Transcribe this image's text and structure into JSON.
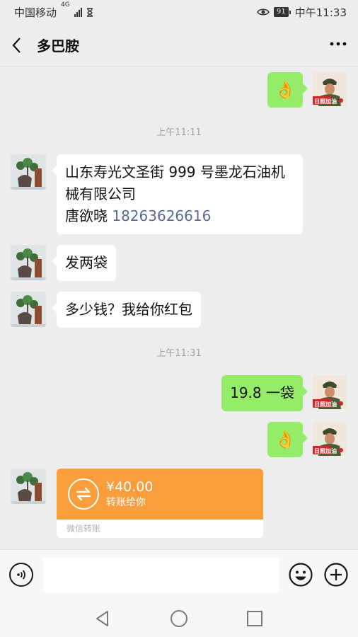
{
  "status_bar": {
    "carrier": "中国移动",
    "network": "4G",
    "battery": "91",
    "time": "中午11:33"
  },
  "header": {
    "title": "多巴胺"
  },
  "messages": {
    "ok_emoji_1": "👌",
    "time_1": "上午11:11",
    "address_line1": "山东寿光文圣街 999 号墨龙石油机",
    "address_line2": "械有限公司",
    "contact_name": "唐欲晓 ",
    "contact_phone": "18263626616",
    "msg_send_two_bags": "发两袋",
    "msg_how_much": "多少钱？我给你红包",
    "time_2": "上午11:31",
    "msg_price": "19.8 一袋",
    "ok_emoji_2": "👌",
    "transfer": {
      "amount": "¥40.00",
      "description": "转账给你",
      "footer": "微信转账"
    }
  },
  "avatar_badge": "日照加油",
  "colors": {
    "sent_bubble": "#95ec69",
    "received_bubble": "#ffffff",
    "transfer_orange": "#fa9d3b",
    "background": "#ededed",
    "link_blue": "#576b95"
  },
  "icons": [
    "back-arrow-icon",
    "more-icon",
    "voice-icon",
    "emoji-icon",
    "plus-icon",
    "back-triangle-icon",
    "home-circle-icon",
    "recents-square-icon",
    "transfer-arrows-icon",
    "eye-icon",
    "hourglass-icon"
  ]
}
